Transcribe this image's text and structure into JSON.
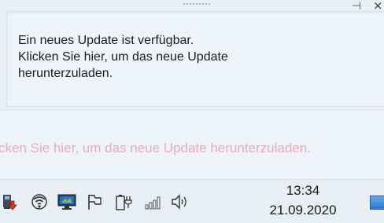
{
  "balloon": {
    "lines": [
      "Ein neues Update ist verfügbar.",
      "Klicken Sie hier, um das neue Update",
      "herunterzuladen."
    ],
    "pin_glyph": "⊣",
    "close_glyph": "×"
  },
  "tooltip": {
    "text": "cken Sie hier, um das neue Update herunterzuladen."
  },
  "taskbar": {
    "icons": [
      "update-icon",
      "wifi-icon",
      "monitor-icon",
      "flag-icon",
      "power-icon",
      "signal-icon",
      "volume-icon",
      "show-desktop-icon"
    ],
    "time": "13:34",
    "date": "21.09.2020"
  },
  "colors": {
    "tooltip_text": "#e7aeb9",
    "show_desktop": "#2f76c8"
  }
}
